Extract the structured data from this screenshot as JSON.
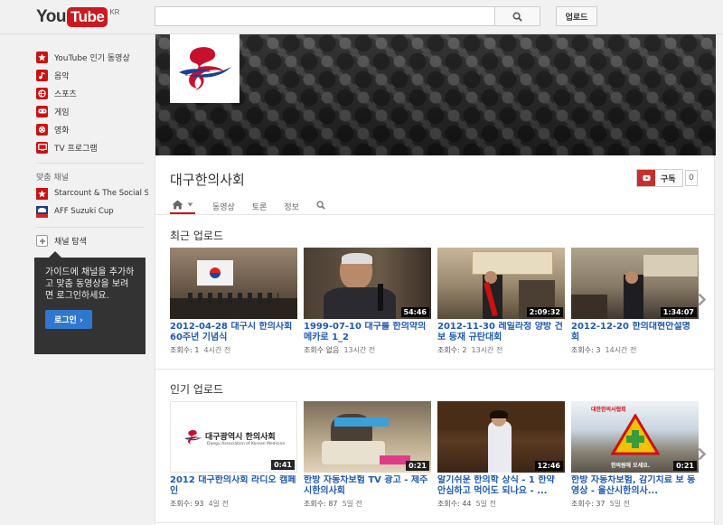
{
  "header": {
    "logo_you": "You",
    "logo_tube": "Tube",
    "logo_region": "KR",
    "search_value": "",
    "upload_label": "업로드"
  },
  "sidebar": {
    "nav": [
      {
        "label": "YouTube 인기 동영상",
        "icon": "star-icon"
      },
      {
        "label": "음악",
        "icon": "music-icon"
      },
      {
        "label": "스포츠",
        "icon": "sports-icon"
      },
      {
        "label": "게임",
        "icon": "gamepad-icon"
      },
      {
        "label": "영화",
        "icon": "film-icon"
      },
      {
        "label": "TV 프로그램",
        "icon": "tv-icon"
      }
    ],
    "subscriptions_title": "맞춤 채널",
    "subscriptions": [
      {
        "label": "Starcount & The Social St..."
      },
      {
        "label": "AFF Suzuki Cup"
      }
    ],
    "browse_label": "채널 탐색",
    "tooltip_text": "가이드에 채널을 추가하고 맞춤 동영상을 보려면 로그인하세요.",
    "login_label": "로그인 ›"
  },
  "channel": {
    "title": "대구한의사회",
    "subscribe_label": "구독",
    "subscriber_count": "0",
    "tabs": [
      "동영상",
      "토론",
      "정보"
    ]
  },
  "recent": {
    "title": "최근 업로드",
    "videos": [
      {
        "title": "2012-04-28 대구시 한의사회 60주년 기념식",
        "views": "조회수: 1",
        "age": "4시간 전",
        "duration": ""
      },
      {
        "title": "1999-07-10 대구를 한의약의 메카로 1_2",
        "views": "조회수 없음",
        "age": "13시간 전",
        "duration": "54:46"
      },
      {
        "title": "2012-11-30 레일라정 양방 건보 등재 규탄대회",
        "views": "조회수: 2",
        "age": "13시간 전",
        "duration": "2:09:32"
      },
      {
        "title": "2012-12-20 한의대현안설명회",
        "views": "조회수: 3",
        "age": "14시간 전",
        "duration": "1:34:07"
      }
    ]
  },
  "popular": {
    "title": "인기 업로드",
    "videos": [
      {
        "title": "2012 대구한의사회 라디오 캠페인",
        "views": "조회수: 93",
        "age": "4일 전",
        "duration": "0:41"
      },
      {
        "title": "한방 자동차보험 TV 광고 - 제주시한의사회",
        "views": "조회수: 87",
        "age": "5일 전",
        "duration": "0:21"
      },
      {
        "title": "알기쉬운 한의학 상식 - 1 한약 안심하고 먹어도 되나요 - ...",
        "views": "조회수: 44",
        "age": "5일 전",
        "duration": "12:46"
      },
      {
        "title": "한방 자동차보험, 감기치료 보 동영상 - 울산시한의사...",
        "views": "조회수: 37",
        "age": "5일 전",
        "duration": "0:21"
      }
    ]
  },
  "thumb_text": {
    "daegu_org": "대구광역시 한의사회",
    "daegu_org_en": "Daegu Association of Korean Medicine",
    "kmedicine_sign": "한의원에 오세요.",
    "kmedicine_header": "대한한의사협회"
  },
  "colors": {
    "brand_red": "#cc181e",
    "link_blue": "#1f59b5",
    "login_blue": "#2f78d0"
  }
}
